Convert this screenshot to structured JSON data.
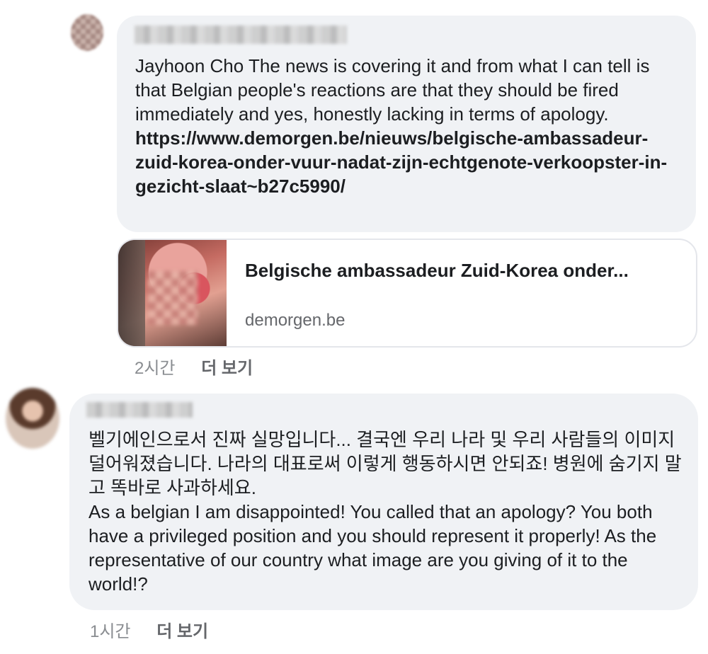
{
  "comments": [
    {
      "text": "Jayhoon Cho The news is covering it and from what I can tell is that Belgian people's reactions are that they should be fired immediately and yes, honestly lacking in terms of apology. ",
      "link": "https://www.demorgen.be/nieuws/belgische-ambassadeur-zuid-korea-onder-vuur-nadat-zijn-echtgenote-verkoopster-in-gezicht-slaat~b27c5990/",
      "preview": {
        "title": "Belgische ambassadeur Zuid-Korea onder...",
        "domain": "demorgen.be"
      },
      "time": "2시간",
      "more": "더 보기"
    },
    {
      "text": "벨기에인으로서 진짜 실망입니다... 결국엔 우리 나라 및 우리 사람들의 이미지 덜어워졌습니다. 나라의 대표로써 이렇게 행동하시면 안되죠! 병원에 숨기지 말고 똑바로 사과하세요.\nAs a belgian I am disappointed! You called that an apology? You both have a privileged position and you should represent it properly! As the representative of our country what image are you giving of it to the world!?",
      "time": "1시간",
      "more": "더 보기"
    }
  ]
}
